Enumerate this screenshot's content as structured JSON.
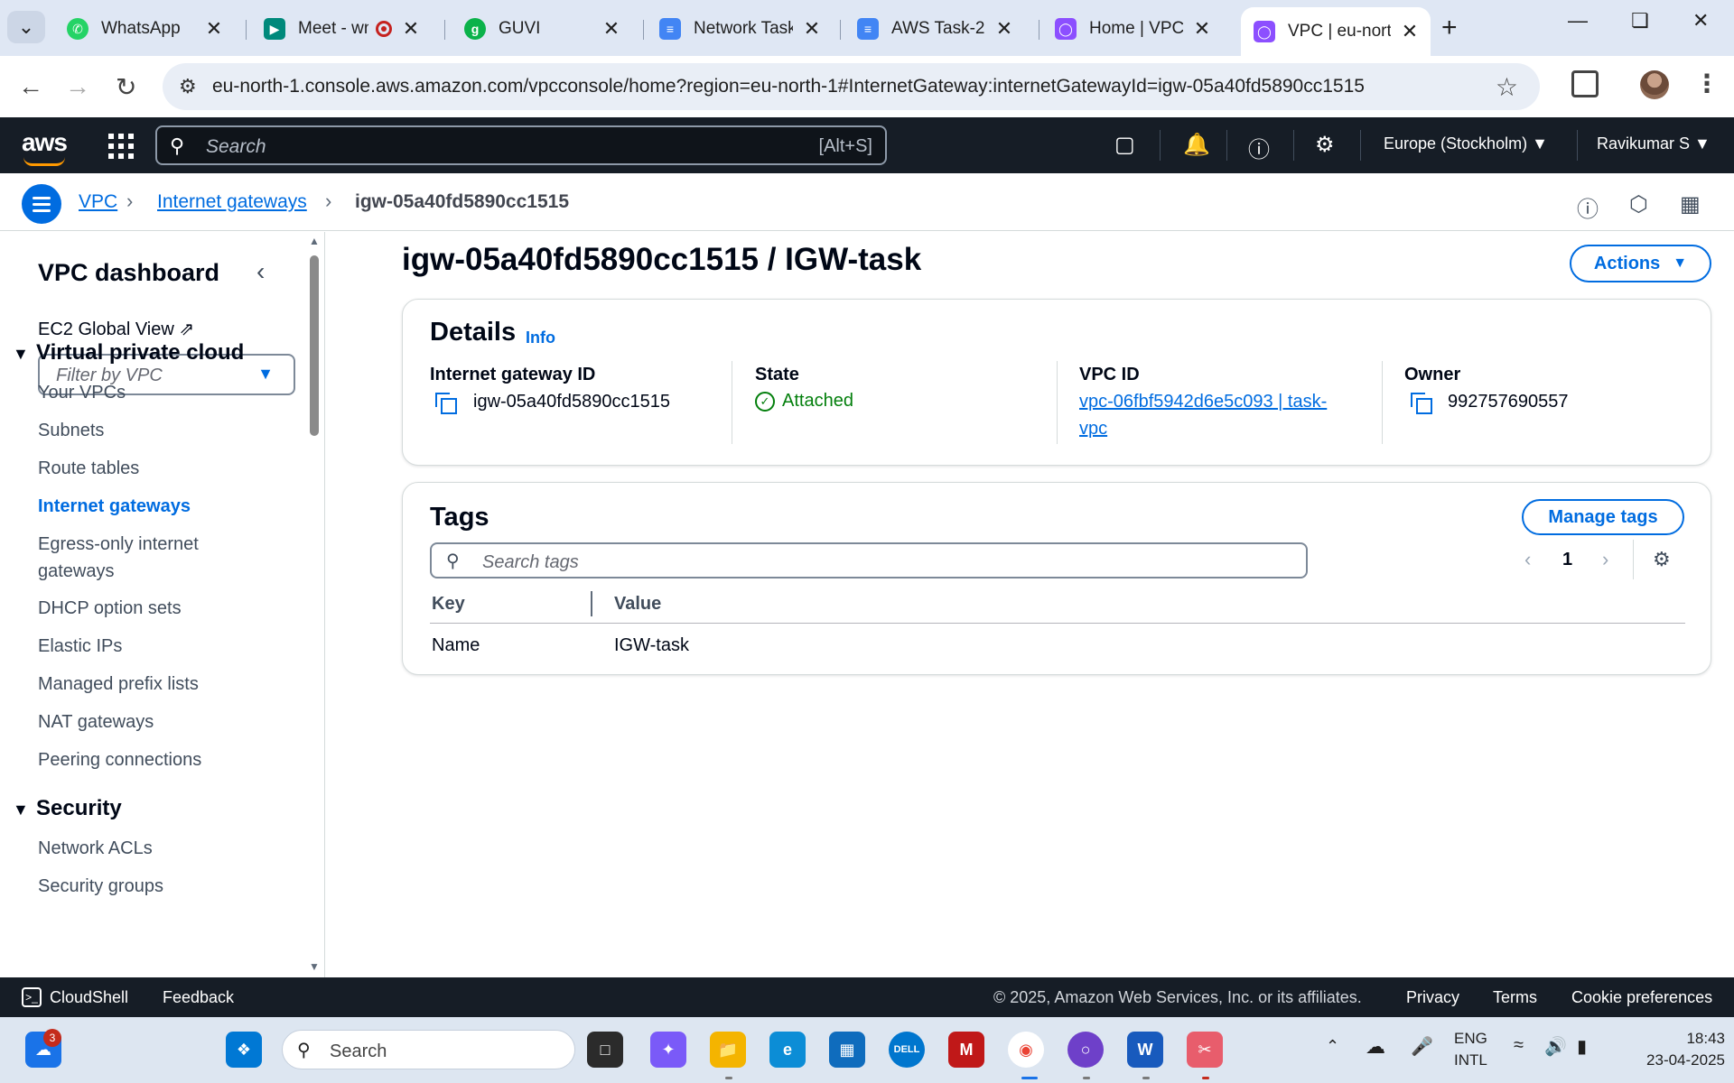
{
  "browser": {
    "tabs": [
      {
        "label": "WhatsApp",
        "icon": "whatsapp-icon",
        "color": "#25d366"
      },
      {
        "label": "Meet - wn",
        "icon": "meet-icon",
        "color": "#00897b"
      },
      {
        "label": "GUVI",
        "icon": "guvi-icon",
        "color": "#0bb24a"
      },
      {
        "label": "Network Task",
        "icon": "docs-icon",
        "color": "#4285f4"
      },
      {
        "label": "AWS Task-2 - ",
        "icon": "docs-icon",
        "color": "#4285f4"
      },
      {
        "label": "Home | VPC | ",
        "icon": "vpc-icon",
        "color": "#8c4fff"
      },
      {
        "label": "VPC | eu-north",
        "icon": "vpc-icon",
        "color": "#8c4fff"
      }
    ],
    "url": "eu-north-1.console.aws.amazon.com/vpcconsole/home?region=eu-north-1#InternetGateway:internetGatewayId=igw-05a40fd5890cc1515"
  },
  "awsnav": {
    "logo": "aws",
    "search_placeholder": "Search",
    "search_hint": "[Alt+S]",
    "region": "Europe (Stockholm)",
    "user": "Ravikumar S"
  },
  "breadcrumb": {
    "items": [
      "VPC",
      "Internet gateways"
    ],
    "current": "igw-05a40fd5890cc1515"
  },
  "sidebar": {
    "title": "VPC dashboard",
    "ec2_global_view": "EC2 Global View",
    "filter_placeholder": "Filter by VPC",
    "sections": [
      {
        "title": "Virtual private cloud",
        "items": [
          "Your VPCs",
          "Subnets",
          "Route tables",
          "Internet gateways",
          "Egress-only internet gateways",
          "DHCP option sets",
          "Elastic IPs",
          "Managed prefix lists",
          "NAT gateways",
          "Peering connections"
        ]
      },
      {
        "title": "Security",
        "items": [
          "Network ACLs",
          "Security groups"
        ]
      }
    ],
    "active_item": "Internet gateways"
  },
  "page": {
    "title": "igw-05a40fd5890cc1515 / IGW-task",
    "actions_label": "Actions"
  },
  "details": {
    "heading": "Details",
    "info": "Info",
    "igw_label": "Internet gateway ID",
    "igw_value": "igw-05a40fd5890cc1515",
    "state_label": "State",
    "state_value": "Attached",
    "vpc_label": "VPC ID",
    "vpc_value": "vpc-06fbf5942d6e5c093 | task-vpc",
    "owner_label": "Owner",
    "owner_value": "992757690557"
  },
  "tags": {
    "heading": "Tags",
    "manage_label": "Manage tags",
    "search_placeholder": "Search tags",
    "page": "1",
    "columns": [
      "Key",
      "Value"
    ],
    "rows": [
      [
        "Name",
        "IGW-task"
      ]
    ]
  },
  "footer": {
    "cloudshell": "CloudShell",
    "feedback": "Feedback",
    "copyright": "© 2025, Amazon Web Services, Inc. or its affiliates.",
    "privacy": "Privacy",
    "terms": "Terms",
    "cookies": "Cookie preferences"
  },
  "taskbar": {
    "search_placeholder": "Search",
    "widget_badge": "3",
    "lang_top": "ENG",
    "lang_bottom": "INTL",
    "time": "18:43",
    "date": "23-04-2025"
  },
  "colors": {
    "aws_dark": "#161d26",
    "link_blue": "#006ce0",
    "success_green": "#037f0c",
    "aws_orange": "#ff9900"
  }
}
